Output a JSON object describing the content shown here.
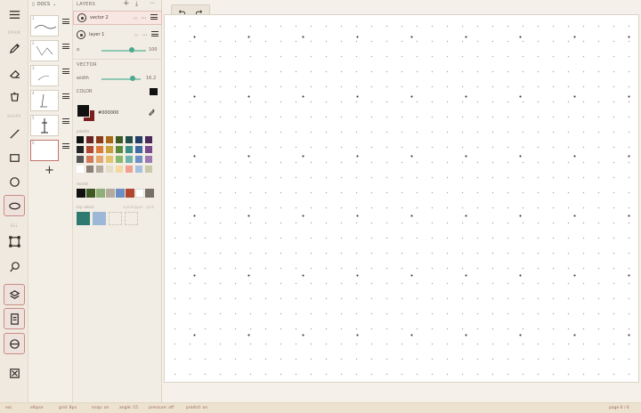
{
  "toolbar": {
    "section_draw": "DRAW",
    "section_shape": "SHAPE",
    "section_select": "SEL",
    "tools": [
      {
        "name": "menu-icon"
      },
      {
        "name": "pencil-icon"
      },
      {
        "name": "eraser-icon"
      },
      {
        "name": "bucket-icon"
      },
      {
        "name": "line-icon"
      },
      {
        "name": "rectangle-icon"
      },
      {
        "name": "circle-icon"
      },
      {
        "name": "ellipse-icon"
      },
      {
        "name": "marquee-icon"
      },
      {
        "name": "lasso-icon"
      },
      {
        "name": "layers-icon"
      },
      {
        "name": "pages-icon"
      },
      {
        "name": "color-icon"
      },
      {
        "name": "export-icon"
      }
    ]
  },
  "pages": {
    "title": "DOCS",
    "numbers": [
      "1",
      "2",
      "3",
      "4",
      "5",
      "6"
    ],
    "add_label": "+"
  },
  "layers": {
    "title": "LAYERS",
    "items": [
      {
        "name": "vector 2"
      },
      {
        "name": "layer 1"
      }
    ],
    "opacity_label": "α",
    "opacity_value": "100",
    "vector_title": "VECTOR",
    "width_label": "width",
    "width_value": "16.2",
    "color_label": "COLOR",
    "hex_value": "#000000",
    "palette_label": "palette",
    "recent_label": "recent",
    "my_colors_label": "my colors",
    "eyedrop_label": "eyedropper · pick"
  },
  "colors": {
    "accent": "#c0736b",
    "teal": "#4ea98e",
    "fg": "#111111",
    "bg": "#7a1f1f",
    "palette": [
      "#111111",
      "#6b2424",
      "#8a3a1a",
      "#a76a18",
      "#3d5a23",
      "#234f4a",
      "#233e68",
      "#4a2a5a",
      "#222222",
      "#b2472f",
      "#d97c3a",
      "#c9a13a",
      "#5b8a3a",
      "#3b8f86",
      "#3e6aa6",
      "#7a4a8f",
      "#555555",
      "#d27a5a",
      "#e3a770",
      "#e4c56d",
      "#8ab86a",
      "#6fb3aa",
      "#6c8fc4",
      "#9e79b0",
      "#ffffff",
      "#8a8078",
      "#b5aa9e",
      "#e6dcc8",
      "#f2d9a0",
      "#f0a090",
      "#a6c1de",
      "#c8c9a8"
    ],
    "recent": [
      "#111111",
      "#3d5a23",
      "#8fae7a",
      "#b5aa9e",
      "#6c8fc4",
      "#b2472f",
      "#ffffff",
      "#777067"
    ],
    "my_colors": [
      "#2e7a70",
      "#9db8d6"
    ]
  },
  "status": {
    "tool": "esc",
    "shape": "ellipse",
    "grid": "grid: 8px",
    "snap": "snap: on",
    "angle": "angle: 15",
    "pressure": "pressure: off",
    "predict": "predict: on",
    "page": "page 6 / 6"
  }
}
